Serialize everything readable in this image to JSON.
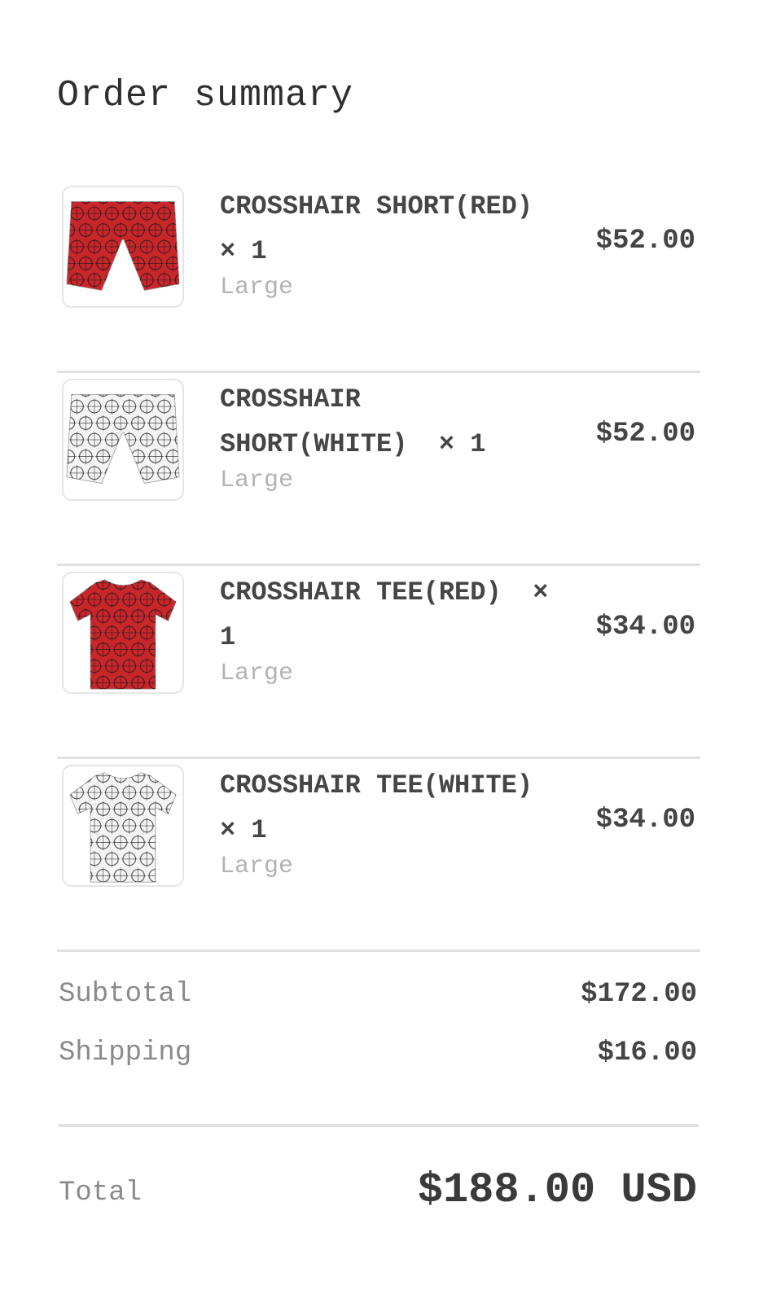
{
  "order_summary": {
    "title": "Order summary",
    "items": [
      {
        "name": "CROSSHAIR SHORT(RED)",
        "quantity_text": "× 1",
        "variant": "Large",
        "price": "$52.00",
        "thumb": {
          "kind": "shorts",
          "color": "#c8262a",
          "pattern": "#1a1a1a"
        }
      },
      {
        "name": "CROSSHAIR SHORT(WHITE)",
        "quantity_text": "× 1",
        "variant": "Large",
        "price": "$52.00",
        "thumb": {
          "kind": "shorts",
          "color": "#f4f4f4",
          "pattern": "#222222"
        }
      },
      {
        "name": "CROSSHAIR TEE(RED)",
        "quantity_text": "× 1",
        "variant": "Large",
        "price": "$34.00",
        "thumb": {
          "kind": "tee",
          "color": "#c8262a",
          "pattern": "#1a1a1a"
        }
      },
      {
        "name": "CROSSHAIR TEE(WHITE)",
        "quantity_text": "× 1",
        "variant": "Large",
        "price": "$34.00",
        "thumb": {
          "kind": "tee",
          "color": "#f4f4f4",
          "pattern": "#222222"
        }
      }
    ],
    "subtotal": {
      "label": "Subtotal",
      "value": "$172.00"
    },
    "shipping": {
      "label": "Shipping",
      "value": "$16.00"
    },
    "total": {
      "label": "Total",
      "value": "$188.00 USD"
    }
  }
}
